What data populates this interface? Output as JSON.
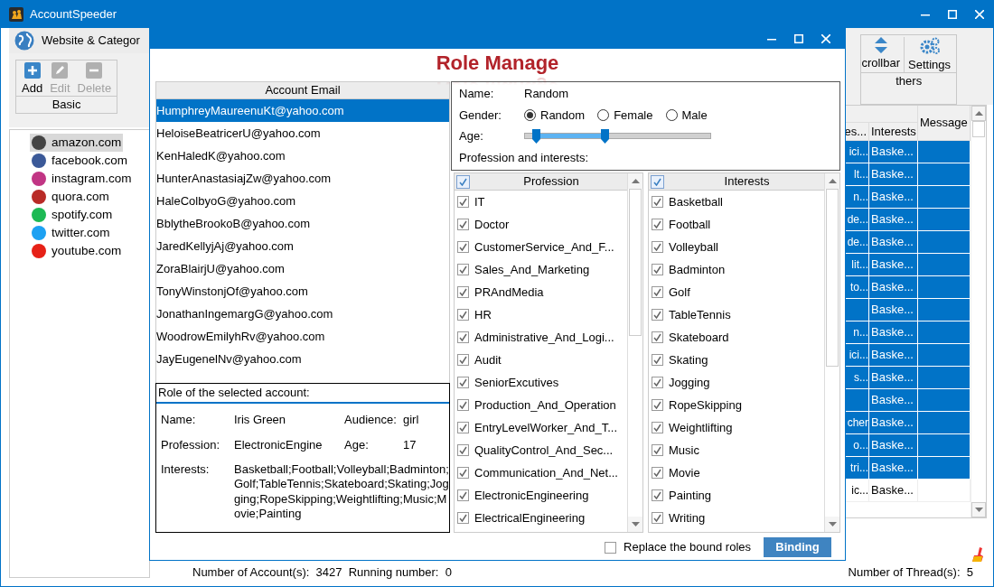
{
  "window": {
    "title": "AccountSpeeder"
  },
  "ribbon": {
    "tab": "Website & Categor",
    "groups": [
      {
        "label": "Basic",
        "buttons": [
          {
            "label": "Add",
            "disabled": false
          },
          {
            "label": "Edit",
            "disabled": true
          },
          {
            "label": "Delete",
            "disabled": true
          }
        ]
      },
      {
        "label": "thers",
        "buttons": [
          {
            "label": "crollbar",
            "disabled": false
          },
          {
            "label": "Settings",
            "disabled": false
          }
        ]
      }
    ]
  },
  "sites": [
    {
      "label": "amazon.com",
      "selected": true,
      "color": "#444444"
    },
    {
      "label": "facebook.com",
      "selected": false,
      "color": "#3b5998"
    },
    {
      "label": "instagram.com",
      "selected": false,
      "color": "#c13584"
    },
    {
      "label": "quora.com",
      "selected": false,
      "color": "#b92b27"
    },
    {
      "label": "spotify.com",
      "selected": false,
      "color": "#1db954"
    },
    {
      "label": "twitter.com",
      "selected": false,
      "color": "#1da1f2"
    },
    {
      "label": "youtube.com",
      "selected": false,
      "color": "#e62117"
    }
  ],
  "table": {
    "columns": [
      "es...",
      "Interests",
      "Message"
    ],
    "rows": [
      {
        "cells": [
          "ici...",
          "Baske...",
          ""
        ],
        "selected": true
      },
      {
        "cells": [
          "lt...",
          "Baske...",
          ""
        ],
        "selected": true
      },
      {
        "cells": [
          "n...",
          "Baske...",
          ""
        ],
        "selected": true
      },
      {
        "cells": [
          "de...",
          "Baske...",
          ""
        ],
        "selected": true
      },
      {
        "cells": [
          "de...",
          "Baske...",
          ""
        ],
        "selected": true
      },
      {
        "cells": [
          "lit...",
          "Baske...",
          ""
        ],
        "selected": true
      },
      {
        "cells": [
          "to...",
          "Baske...",
          ""
        ],
        "selected": true
      },
      {
        "cells": [
          "",
          "Baske...",
          ""
        ],
        "selected": true
      },
      {
        "cells": [
          "n...",
          "Baske...",
          ""
        ],
        "selected": true
      },
      {
        "cells": [
          "ici...",
          "Baske...",
          ""
        ],
        "selected": true
      },
      {
        "cells": [
          "s...",
          "Baske...",
          ""
        ],
        "selected": true
      },
      {
        "cells": [
          "",
          "Baske...",
          ""
        ],
        "selected": true
      },
      {
        "cells": [
          "cher",
          "Baske...",
          ""
        ],
        "selected": true
      },
      {
        "cells": [
          "o...",
          "Baske...",
          ""
        ],
        "selected": true
      },
      {
        "cells": [
          "tri...",
          "Baske...",
          ""
        ],
        "selected": true
      },
      {
        "cells": [
          "ic...",
          "Baske...",
          ""
        ],
        "selected": false
      }
    ]
  },
  "status_bar": {
    "accounts_label": "Number of Account(s):",
    "accounts": "3427",
    "running_label": "Running number:",
    "running": "0",
    "threads_label": "Number of Thread(s):",
    "threads": "5"
  },
  "dialog": {
    "title": "Role Manage",
    "accounts": {
      "column": "Account Email",
      "rows": [
        {
          "email": "HumphreyMaureenuKt@yahoo.com",
          "selected": true
        },
        {
          "email": "HeloiseBeatricerU@yahoo.com",
          "selected": false
        },
        {
          "email": "KenHaledK@yahoo.com",
          "selected": false
        },
        {
          "email": "HunterAnastasiajZw@yahoo.com",
          "selected": false
        },
        {
          "email": "HaleColbyoG@yahoo.com",
          "selected": false
        },
        {
          "email": "BblytheBrookoB@yahoo.com",
          "selected": false
        },
        {
          "email": "JaredKellyjAj@yahoo.com",
          "selected": false
        },
        {
          "email": "ZoraBlairjU@yahoo.com",
          "selected": false
        },
        {
          "email": "TonyWinstonjOf@yahoo.com",
          "selected": false
        },
        {
          "email": "JonathanIngemargG@yahoo.com",
          "selected": false
        },
        {
          "email": "WoodrowEmilyhRv@yahoo.com",
          "selected": false
        },
        {
          "email": "JayEugenelNv@yahoo.com",
          "selected": false
        }
      ]
    },
    "role": {
      "heading": "Role of the selected account:",
      "fields": [
        {
          "label": "Name:",
          "value": "Iris Green"
        },
        {
          "label": "Audience:",
          "value": "girl"
        },
        {
          "label": "Profession:",
          "value": "ElectronicEngine"
        },
        {
          "label": "Age:",
          "value": "17"
        },
        {
          "label": "Interests:",
          "value": "Basketball;Football;Volleyball;Badminton;Golf;TableTennis;Skateboard;Skating;Jogging;RopeSkipping;Weightlifting;Music;Movie;Painting"
        }
      ]
    },
    "filter": {
      "name_label": "Name:",
      "name": "Random",
      "gender_label": "Gender:",
      "genders": [
        {
          "label": "Random",
          "selected": true
        },
        {
          "label": "Female",
          "selected": false
        },
        {
          "label": "Male",
          "selected": false
        }
      ],
      "age_label": "Age:",
      "age_thumbs": [
        {
          "level": 0.06
        },
        {
          "level": 0.43
        }
      ],
      "interests_label": "Profession and interests:"
    },
    "lists": [
      {
        "column": "Profession",
        "all_checked": true,
        "items": [
          {
            "label": "IT",
            "checked": true
          },
          {
            "label": "Doctor",
            "checked": true
          },
          {
            "label": "CustomerService_And_F...",
            "checked": true
          },
          {
            "label": "Sales_And_Marketing",
            "checked": true
          },
          {
            "label": "PRAndMedia",
            "checked": true
          },
          {
            "label": "HR",
            "checked": true
          },
          {
            "label": "Administrative_And_Logi...",
            "checked": true
          },
          {
            "label": "Audit",
            "checked": true
          },
          {
            "label": "SeniorExcutives",
            "checked": true
          },
          {
            "label": "Production_And_Operation",
            "checked": true
          },
          {
            "label": "EntryLevelWorker_And_T...",
            "checked": true
          },
          {
            "label": "QualityControl_And_Sec...",
            "checked": true
          },
          {
            "label": "Communication_And_Net...",
            "checked": true
          },
          {
            "label": "ElectronicEngineering",
            "checked": true
          },
          {
            "label": "ElectricalEngineering",
            "checked": true
          }
        ]
      },
      {
        "column": "Interests",
        "all_checked": true,
        "items": [
          {
            "label": "Basketball",
            "checked": true
          },
          {
            "label": "Football",
            "checked": true
          },
          {
            "label": "Volleyball",
            "checked": true
          },
          {
            "label": "Badminton",
            "checked": true
          },
          {
            "label": "Golf",
            "checked": true
          },
          {
            "label": "TableTennis",
            "checked": true
          },
          {
            "label": "Skateboard",
            "checked": true
          },
          {
            "label": "Skating",
            "checked": true
          },
          {
            "label": "Jogging",
            "checked": true
          },
          {
            "label": "RopeSkipping",
            "checked": true
          },
          {
            "label": "Weightlifting",
            "checked": true
          },
          {
            "label": "Music",
            "checked": true
          },
          {
            "label": "Movie",
            "checked": true
          },
          {
            "label": "Painting",
            "checked": true
          },
          {
            "label": "Writing",
            "checked": true
          }
        ]
      }
    ],
    "replace_bound": {
      "label": "Replace the bound roles",
      "checked": false
    },
    "binding_button": "Binding"
  }
}
